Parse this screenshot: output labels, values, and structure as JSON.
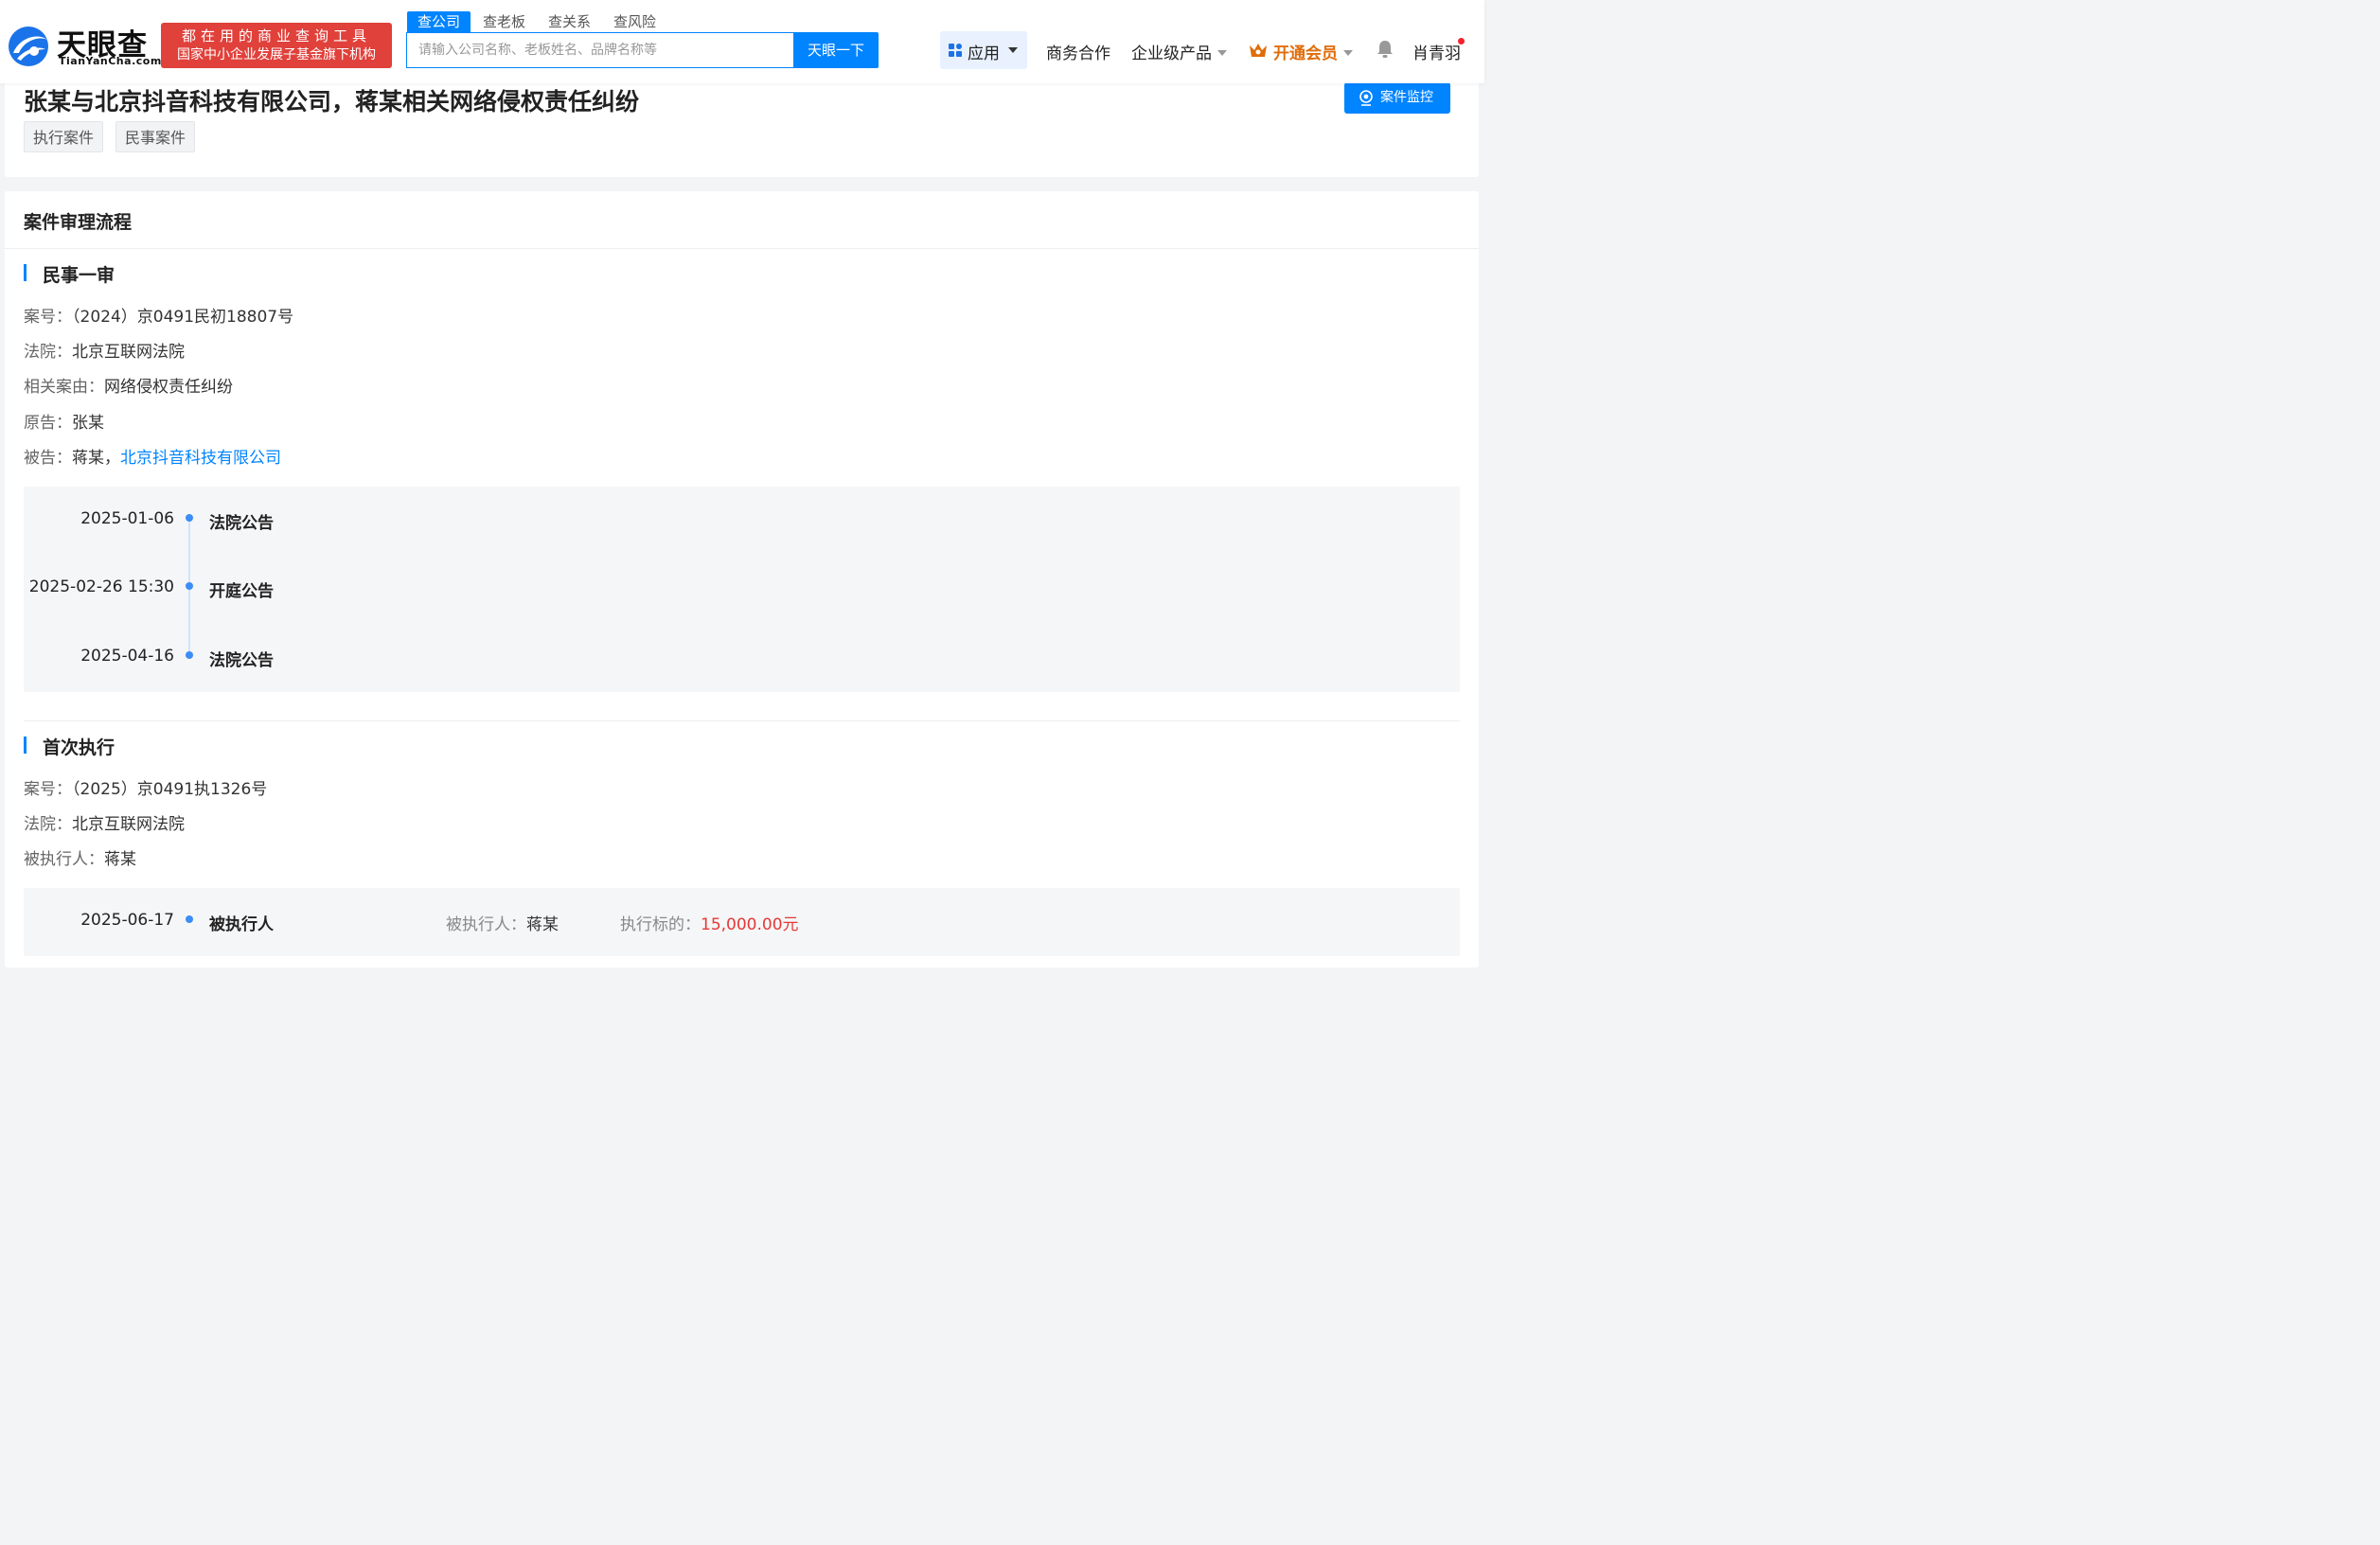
{
  "header": {
    "logo_cn": "天眼查",
    "logo_en": "TianYanCha.com",
    "slogan_line1": "都在用的商业查询工具",
    "slogan_line2": "国家中小企业发展子基金旗下机构",
    "search_tabs": [
      "查公司",
      "查老板",
      "查关系",
      "查风险"
    ],
    "search_placeholder": "请输入公司名称、老板姓名、品牌名称等",
    "search_button": "天眼一下",
    "nav": {
      "app": "应用",
      "business": "商务合作",
      "enterprise": "企业级产品",
      "vip": "开通会员",
      "user": "肖青羽"
    }
  },
  "case": {
    "title": "张某与北京抖音科技有限公司，蒋某相关网络侵权责任纠纷",
    "tags": [
      "执行案件",
      "民事案件"
    ],
    "monitor_button": "案件监控"
  },
  "process": {
    "heading": "案件审理流程",
    "stages": [
      {
        "title": "民事一审",
        "fields": [
          {
            "label": "案号：",
            "value": "（2024）京0491民初18807号"
          },
          {
            "label": "法院：",
            "value": "北京互联网法院"
          },
          {
            "label": "相关案由：",
            "value": "网络侵权责任纠纷"
          },
          {
            "label": "原告：",
            "value": "张某"
          },
          {
            "label": "被告：",
            "value": "蒋某，",
            "link": "北京抖音科技有限公司"
          }
        ],
        "timeline": [
          {
            "date": "2025-01-06",
            "event": "法院公告"
          },
          {
            "date": "2025-02-26 15:30",
            "event": "开庭公告"
          },
          {
            "date": "2025-04-16",
            "event": "法院公告"
          }
        ]
      },
      {
        "title": "首次执行",
        "fields": [
          {
            "label": "案号：",
            "value": "（2025）京0491执1326号"
          },
          {
            "label": "法院：",
            "value": "北京互联网法院"
          },
          {
            "label": "被执行人：",
            "value": "蒋某"
          }
        ],
        "timeline": [
          {
            "date": "2025-06-17",
            "event": "被执行人",
            "executed_label": "被执行人：",
            "executed_value": "蒋某",
            "amount_label": "执行标的：",
            "amount_value": "15,000.00元"
          }
        ]
      }
    ]
  },
  "colors": {
    "accent": "#0084ff",
    "slogan_bg": "#e0413b",
    "vip": "#e06c0a",
    "amount": "#e53935"
  }
}
